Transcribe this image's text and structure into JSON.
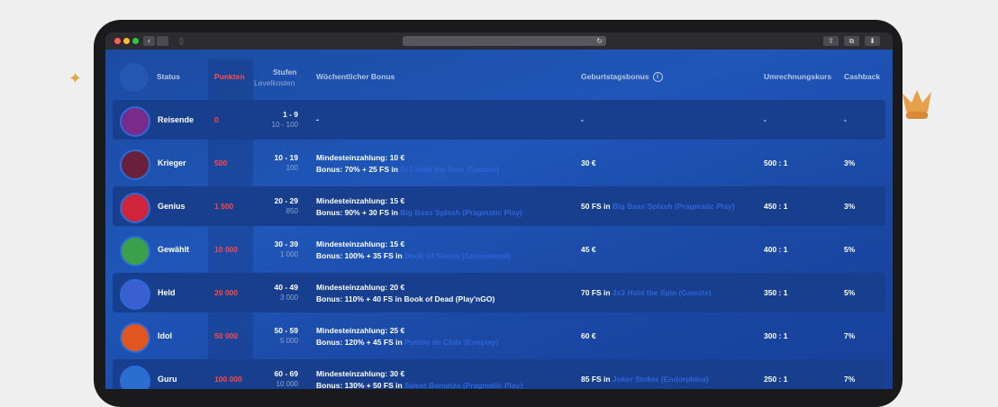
{
  "header": {
    "status": "Status",
    "points": "Punkten",
    "levels": "Stufen",
    "level_costs": "Levelkosten",
    "weekly_bonus": "Wöchentlicher Bonus",
    "birthday_bonus": "Geburtstagsbonus",
    "birthday_info": "i",
    "exchange_rate": "Umrechnungskurs",
    "cashback": "Cashback"
  },
  "rows": [
    {
      "status": "Reisende",
      "points": "0",
      "levels": "1 - 9",
      "cost": "10 - 100",
      "weekly_line1": "-",
      "weekly_line2_pre": "",
      "weekly_link": "",
      "birthday_pre": "-",
      "birthday_link": "",
      "rate": "-",
      "cashback": "-",
      "avatar_color": "#7a2a8a"
    },
    {
      "status": "Krieger",
      "points": "500",
      "levels": "10 - 19",
      "cost": "100",
      "weekly_line1": "Mindesteinzahlung: 10 €",
      "weekly_line2_pre": "Bonus: 70% + 25 FS in ",
      "weekly_link": "3x3 Hold the Spin (Gamzix)",
      "birthday_pre": "30 €",
      "birthday_link": "",
      "rate": "500 : 1",
      "cashback": "3%",
      "avatar_color": "#6a1f3a"
    },
    {
      "status": "Genius",
      "points": "1 500",
      "levels": "20 - 29",
      "cost": "850",
      "weekly_line1": "Mindesteinzahlung: 15 €",
      "weekly_line2_pre": "Bonus: 90% + 30 FS in ",
      "weekly_link": "Big Bass Splash (Pragmatic Play)",
      "birthday_pre": "50 FS in ",
      "birthday_link": "Big Bass Splash (Pragmatic Play)",
      "rate": "450 : 1",
      "cashback": "3%",
      "avatar_color": "#d0243a"
    },
    {
      "status": "Gewählt",
      "points": "10 000",
      "levels": "30 - 39",
      "cost": "1 000",
      "weekly_line1": "Mindesteinzahlung: 15 €",
      "weekly_line2_pre": "Bonus: 100% + 35 FS in ",
      "weekly_link": "Book Of Sirens (Spinomenal)",
      "birthday_pre": "45 €",
      "birthday_link": "",
      "rate": "400 : 1",
      "cashback": "5%",
      "avatar_color": "#3aa04a"
    },
    {
      "status": "Held",
      "points": "20 000",
      "levels": "40 - 49",
      "cost": "3 000",
      "weekly_line1": "Mindesteinzahlung: 20 €",
      "weekly_line2_pre": "Bonus: 110% + 40 FS in Book of Dead (Play'nGO)",
      "weekly_link": "",
      "birthday_pre": "70 FS in ",
      "birthday_link": "3x3 Hold the Spin (Gamzix)",
      "rate": "350 : 1",
      "cashback": "5%",
      "avatar_color": "#3a5fd0"
    },
    {
      "status": "Idol",
      "points": "50 000",
      "levels": "50 - 59",
      "cost": "5 000",
      "weekly_line1": "Mindesteinzahlung: 25 €",
      "weekly_line2_pre": "Bonus: 120% + 45 FS in ",
      "weekly_link": "Pueblo de Chile (Evoplay)",
      "birthday_pre": "60 €",
      "birthday_link": "",
      "rate": "300 : 1",
      "cashback": "7%",
      "avatar_color": "#e0561e"
    },
    {
      "status": "Guru",
      "points": "100 000",
      "levels": "60 - 69",
      "cost": "10 000",
      "weekly_line1": "Mindesteinzahlung: 30 €",
      "weekly_line2_pre": "Bonus: 130% + 50 FS in ",
      "weekly_link": "Sweet Bonanza (Pragmatic Play)",
      "birthday_pre": "85 FS in ",
      "birthday_link": "Joker Stoker (Endorphina)",
      "rate": "250 : 1",
      "cashback": "7%",
      "avatar_color": "#2a6fd0"
    }
  ]
}
